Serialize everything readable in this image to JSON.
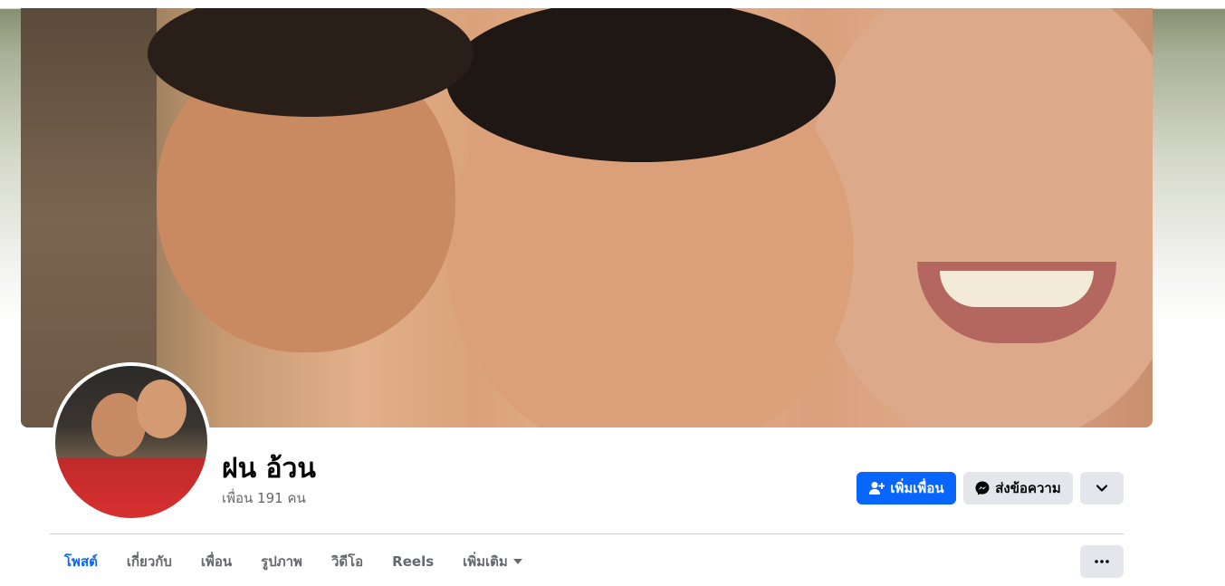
{
  "profile": {
    "name": "ฝน อ้วน",
    "friends_count_text": "เพื่อน 191 คน"
  },
  "actions": {
    "add_friend_label": "เพิ่มเพื่อน",
    "message_label": "ส่งข้อความ",
    "add_friend_icon": "person-plus-icon",
    "message_icon": "messenger-icon",
    "more_icon": "chevron-down-icon"
  },
  "tabs": [
    {
      "label": "โพสต์",
      "active": true
    },
    {
      "label": "เกี่ยวกับ",
      "active": false
    },
    {
      "label": "เพื่อน",
      "active": false
    },
    {
      "label": "รูปภาพ",
      "active": false
    },
    {
      "label": "วิดีโอ",
      "active": false
    },
    {
      "label": "Reels",
      "active": false
    },
    {
      "label": "เพิ่มเติม",
      "active": false
    }
  ],
  "colors": {
    "accent": "#0866ff",
    "button_secondary": "#e4e6eb",
    "text_primary": "#050505",
    "text_secondary": "#65676b"
  }
}
